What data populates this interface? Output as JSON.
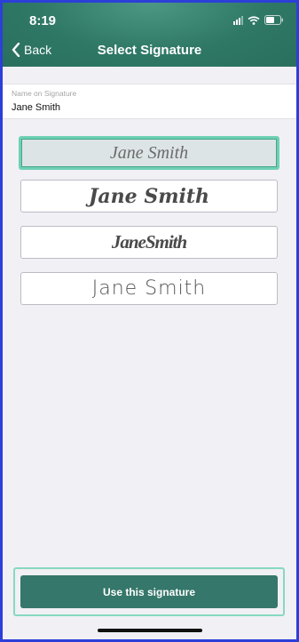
{
  "status_bar": {
    "time": "8:19"
  },
  "nav": {
    "back_label": "Back",
    "title": "Select Signature"
  },
  "name_field": {
    "caption": "Name on Signature",
    "value": "Jane Smith"
  },
  "signatures": [
    {
      "text": "Jane Smith",
      "selected": true
    },
    {
      "text": "Jane Smith",
      "selected": false
    },
    {
      "text": "JaneSmith",
      "selected": false
    },
    {
      "text": "Jane Smith",
      "selected": false
    }
  ],
  "action": {
    "label": "Use this signature"
  },
  "colors": {
    "header": "#2f7866",
    "accent": "#6fd0b4",
    "button": "#35776a",
    "background": "#f1f0f5"
  }
}
